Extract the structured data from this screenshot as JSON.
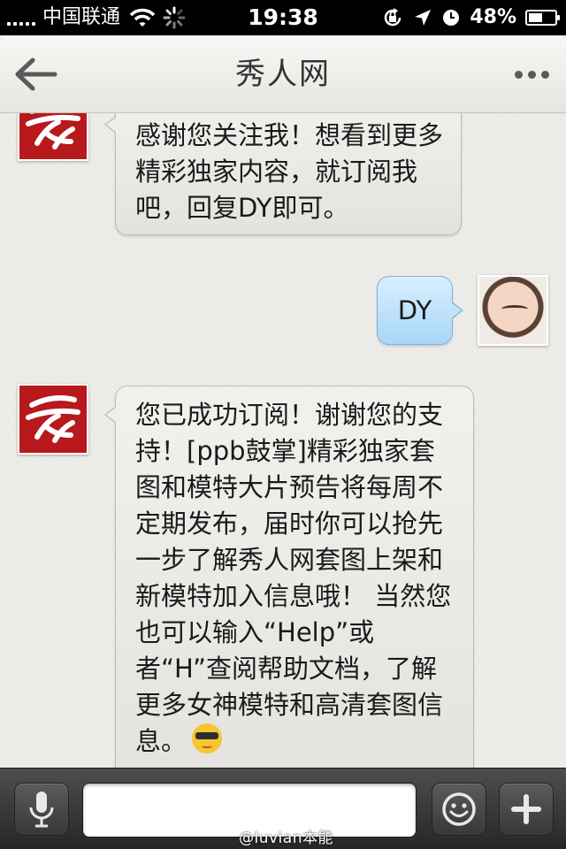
{
  "status_bar": {
    "carrier": "中国联通",
    "time": "19:38",
    "battery": "48%",
    "battery_level": 0.48,
    "icons": [
      "signal-icon",
      "wifi-icon",
      "activity-spinner-icon",
      "orientation-lock-icon",
      "location-arrow-icon",
      "alarm-clock-icon",
      "battery-icon"
    ]
  },
  "nav": {
    "title": "秀人网",
    "back_icon": "back-arrow-icon",
    "more_icon": "more-dots-icon"
  },
  "messages": [
    {
      "sender": "brand",
      "direction": "in",
      "text": "感谢您关注我！想看到更多精彩独家内容，就订阅我吧，回复DY即可。"
    },
    {
      "sender": "user",
      "direction": "out",
      "text": "DY"
    },
    {
      "sender": "brand",
      "direction": "in",
      "text": "您已成功订阅！谢谢您的支持！[ppb鼓掌]精彩独家套图和模特大片预告将每周不定期发布，届时你可以抢先一步了解秀人网套图上架和新模特加入信息哦！ 当然您也可以输入“Help”或者“H”查阅帮助文档，了解更多女神模特和高清套图信息。",
      "emoji": "sunglasses-emoji"
    }
  ],
  "input_bar": {
    "value": "",
    "placeholder": "",
    "voice_icon": "microphone-icon",
    "emoji_icon": "smiley-icon",
    "plus_icon": "plus-icon"
  },
  "watermark": "@luvian本能",
  "colors": {
    "brand_red": "#b7191d",
    "outgoing_bubble": "#b7dcf8",
    "incoming_bubble": "#ebeae7",
    "status_bar": "#000000",
    "input_bar": "#3a3a3a"
  }
}
